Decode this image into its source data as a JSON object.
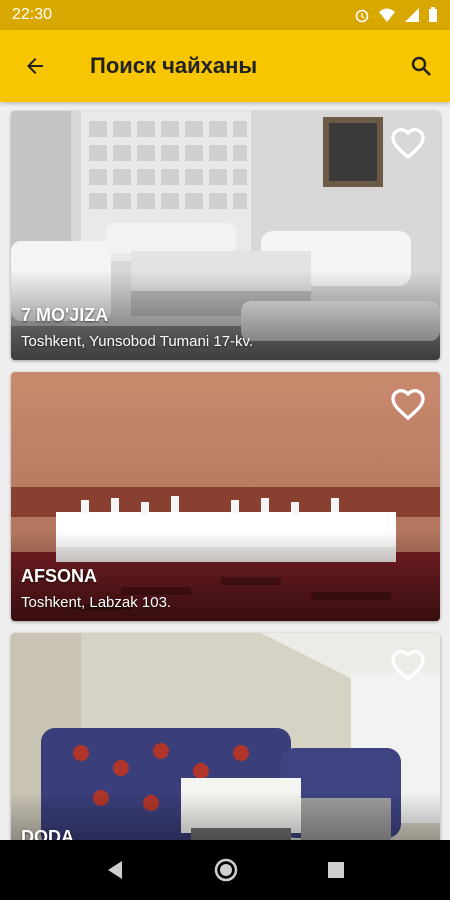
{
  "status_bar": {
    "time": "22:30"
  },
  "app_bar": {
    "title": "Поиск чайханы"
  },
  "cards": [
    {
      "name": "7 MO'JIZA",
      "address": "Toshkent, Yunsobod Tumani 17-kv."
    },
    {
      "name": "AFSONA",
      "address": "Toshkent, Labzak 103."
    },
    {
      "name": "DODA",
      "address": ""
    }
  ],
  "colors": {
    "accent": "#f7c600",
    "status_bar": "#d9a800"
  }
}
